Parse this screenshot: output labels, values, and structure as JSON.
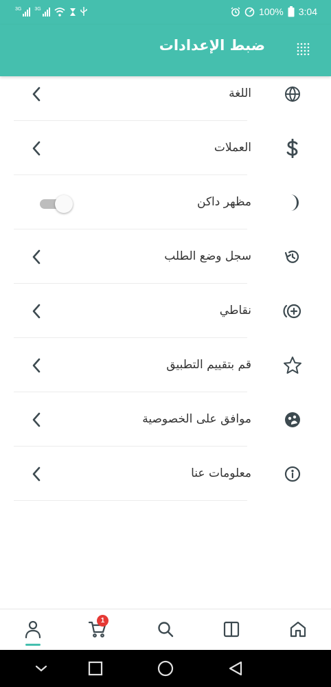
{
  "status_bar": {
    "network_1": "3G",
    "network_2": "3G",
    "battery": "100%",
    "time": "3:04"
  },
  "header": {
    "title": "ضبط الإعدادات",
    "menu_icon": "grid-dots-icon"
  },
  "settings": [
    {
      "label": "اللغة",
      "icon": "globe-icon",
      "control": "chevron"
    },
    {
      "label": "العملات",
      "icon": "dollar-icon",
      "control": "chevron"
    },
    {
      "label": "مظهر داكن",
      "icon": "moon-icon",
      "control": "toggle",
      "toggle_on": false
    },
    {
      "label": "سجل وضع الطلب",
      "icon": "history-icon",
      "control": "chevron"
    },
    {
      "label": "نقاطي",
      "icon": "points-plus-icon",
      "control": "chevron"
    },
    {
      "label": "قم بتقييم التطبيق",
      "icon": "star-icon",
      "control": "chevron"
    },
    {
      "label": "موافق على الخصوصية",
      "icon": "privacy-icon",
      "control": "chevron"
    },
    {
      "label": "معلومات عنا",
      "icon": "info-icon",
      "control": "chevron"
    }
  ],
  "bottom_nav": {
    "items": [
      "profile-icon",
      "cart-icon",
      "search-icon",
      "categories-icon",
      "home-icon"
    ],
    "active": "profile-icon",
    "cart_badge": "1"
  },
  "colors": {
    "accent": "#45bfae",
    "icon": "#3d4a50",
    "badge": "#e53935"
  }
}
